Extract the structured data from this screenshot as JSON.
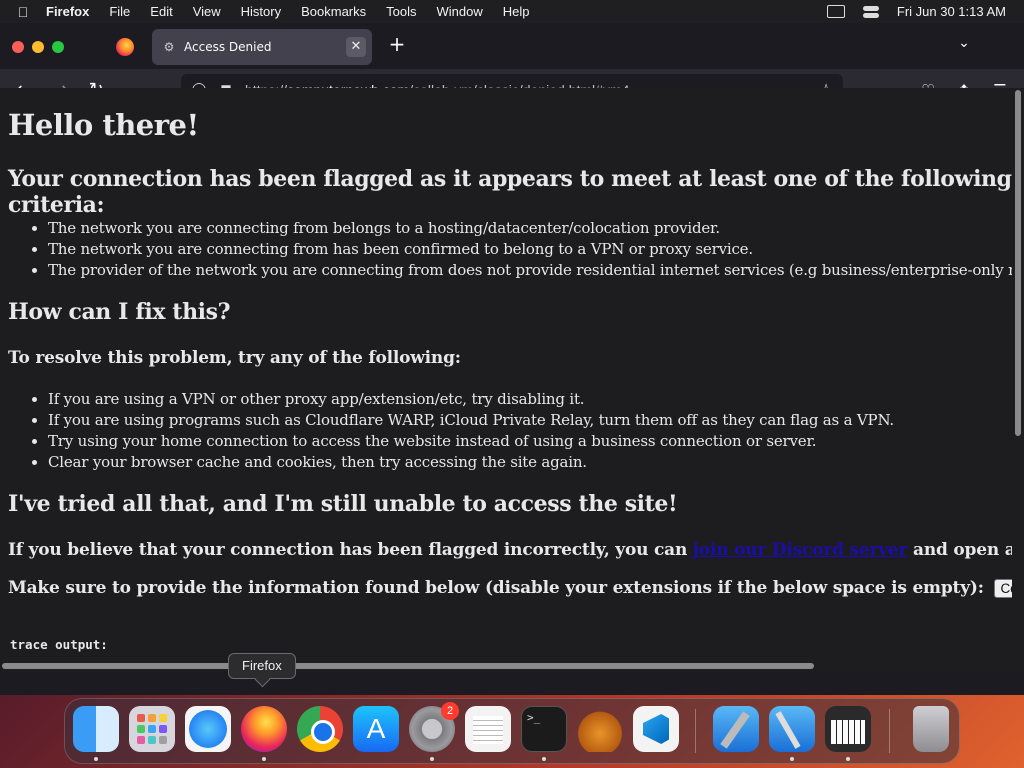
{
  "menubar": {
    "app_name": "Firefox",
    "items": [
      "File",
      "Edit",
      "View",
      "History",
      "Bookmarks",
      "Tools",
      "Window",
      "Help"
    ],
    "clock": "Fri Jun 30  1:13 AM"
  },
  "browser": {
    "active_tab_title": "Access Denied",
    "url_host": "computernewb.com",
    "url_prefix": "https://",
    "url_path": "/collab-vm/classic/denied.html#vm4"
  },
  "page": {
    "heading": "Hello there!",
    "criteria_heading": "Your connection has been flagged as it appears to meet at least one of the following criteria:",
    "criteria": [
      "The network you are connecting from belongs to a hosting/datacenter/colocation provider.",
      "The network you are connecting from has been confirmed to belong to a VPN or proxy service.",
      "The provider of the network you are connecting from does not provide residential internet services (e.g business/enterprise-only networks)."
    ],
    "fix_heading": "How can I fix this?",
    "resolve_heading": "To resolve this problem, try any of the following:",
    "fixes": [
      "If you are using a VPN or other proxy app/extension/etc, try disabling it.",
      "If you are using programs such as Cloudflare WARP, iCloud Private Relay, turn them off as they can flag as a VPN.",
      "Try using your home connection to access the website instead of using a business connection or server.",
      "Clear your browser cache and cookies, then try accessing the site again."
    ],
    "tried_heading": "I've tried all that, and I'm still unable to access the site!",
    "incorrect_prefix": "If you believe that your connection has been flagged incorrectly, you can",
    "discord_link": "join our Discord server",
    "incorrect_suffix": "and open a ticket.",
    "info_text": "Make sure to provide the information found below (disable your extensions if the below space is empty):",
    "copy_button": "Copy to clipboard",
    "trace_label": "trace output:"
  },
  "tooltip": "Firefox",
  "dock": {
    "settings_badge": "2",
    "terminal_prompt": ">_"
  }
}
